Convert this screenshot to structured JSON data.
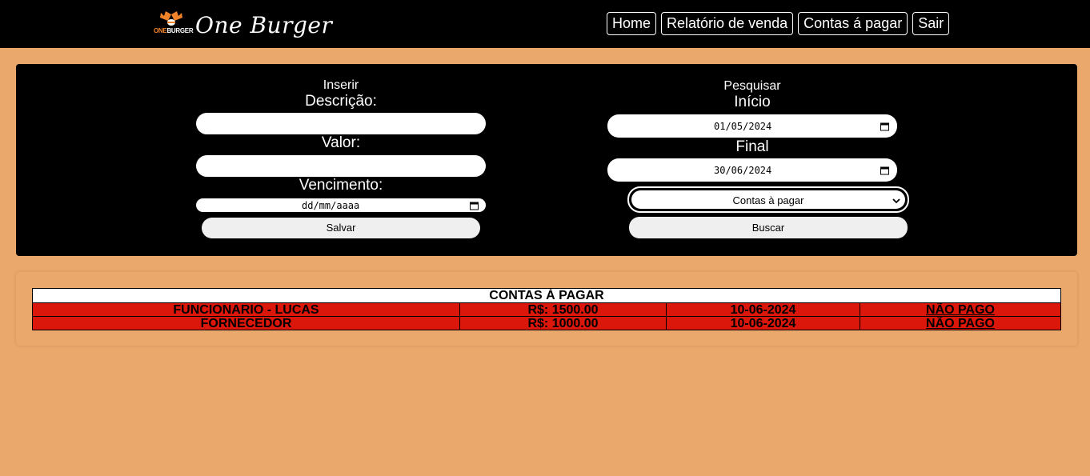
{
  "header": {
    "logo_badge_part1": "ONE",
    "logo_badge_part2": "BURGER",
    "brand": "One Burger",
    "nav": [
      "Home",
      "Relatório de venda",
      "Contas á pagar",
      "Sair"
    ]
  },
  "insert": {
    "title": "Inserir",
    "descricao_label": "Descrição:",
    "descricao_value": "",
    "valor_label": "Valor:",
    "valor_value": "",
    "vencimento_label": "Vencimento:",
    "vencimento_placeholder": "dd/mm/aaaa",
    "save_label": "Salvar"
  },
  "search": {
    "title": "Pesquisar",
    "inicio_label": "Início",
    "inicio_value": "01/05/2024",
    "final_label": "Final",
    "final_value": "30/06/2024",
    "type_selected": "Contas à pagar",
    "search_label": "Buscar"
  },
  "bills_table": {
    "title": "CONTAS À PAGAR",
    "rows": [
      [
        "FUNCIONARIO - LUCAS",
        "R$: 1500.00",
        "10-06-2024",
        "NÃO PAGO"
      ],
      [
        "FORNECEDOR",
        "R$: 1000.00",
        "10-06-2024",
        "NÃO PAGO"
      ]
    ]
  },
  "colors": {
    "page_background": "#eba86c",
    "bar_background": "#000000",
    "unpaid_row": "#db160a",
    "logo_orange": "#f0832a"
  }
}
